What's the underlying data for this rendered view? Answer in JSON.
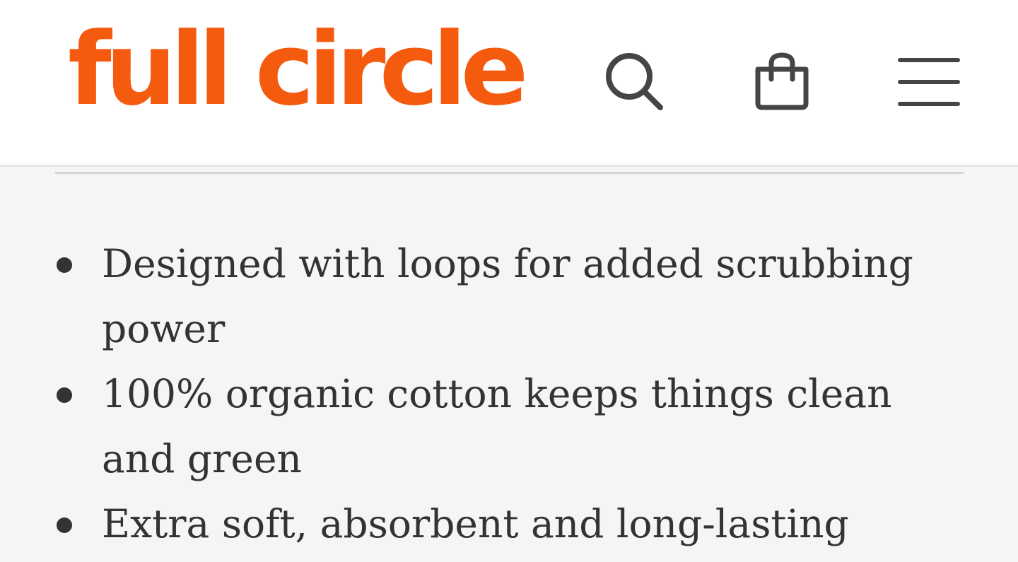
{
  "header": {
    "logo_text": "full circle",
    "brand_color": "#f45b0f",
    "icons": {
      "search": "search-icon",
      "cart": "shopping-bag-icon",
      "menu": "hamburger-menu-icon"
    }
  },
  "features": [
    "Designed with loops for added scrubbing power",
    "100% organic cotton keeps things clean and green",
    "Extra soft, absorbent and long-lasting"
  ]
}
